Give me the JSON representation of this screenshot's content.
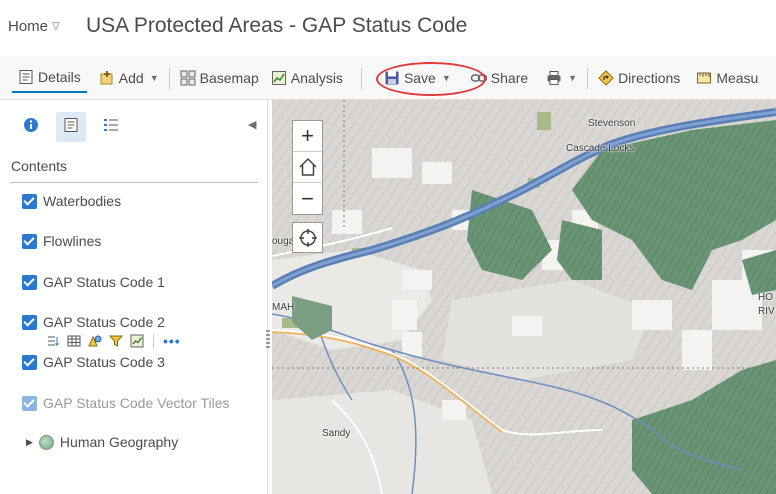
{
  "header": {
    "home_label": "Home",
    "home_caret": "▽",
    "title": "USA Protected Areas - GAP Status Code"
  },
  "toolbar": {
    "details": "Details",
    "add": "Add",
    "basemap": "Basemap",
    "analysis": "Analysis",
    "save": "Save",
    "share": "Share",
    "directions": "Directions",
    "measure": "Measu",
    "caret": "▼"
  },
  "sidebar": {
    "contents_heading": "Contents",
    "collapse_glyph": "◀",
    "group_caret": "▶",
    "layers": [
      {
        "label": "Waterbodies"
      },
      {
        "label": "Flowlines"
      },
      {
        "label": "GAP Status Code 1"
      },
      {
        "label": "GAP Status Code 2"
      },
      {
        "label": "GAP Status Code 3"
      },
      {
        "label": "GAP Status Code Vector Tiles"
      }
    ],
    "more_glyph": "•••",
    "group_label": "Human Geography"
  },
  "map": {
    "labels": {
      "stevenson": "Stevenson",
      "cascade_locks": "Cascade Locks",
      "ouga": "ouga",
      "mah": "MAH",
      "sandy": "Sandy",
      "ho": "HO",
      "riv": "RIV"
    },
    "zoom_in": "+",
    "zoom_out": "−"
  },
  "colors": {
    "accent": "#0079c1",
    "checkbox": "#2d78cf",
    "river": "#5a7fb5",
    "protected": "#5f8d6b",
    "highlight": "#e03b3b"
  }
}
